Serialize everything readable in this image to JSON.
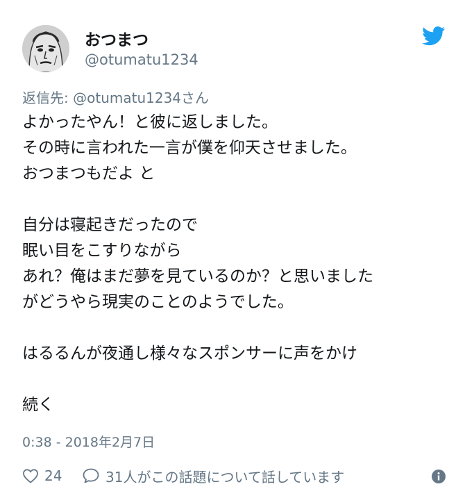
{
  "user": {
    "display_name": "おつまつ",
    "handle": "@otumatu1234"
  },
  "reply_to": {
    "prefix": "返信先: ",
    "mention": "@otumatu1234",
    "suffix": "さん"
  },
  "body_lines": [
    "よかったやん！と彼に返しました。",
    "その時に言われた一言が僕を仰天させました。",
    "おつまつもだよ と",
    "",
    "自分は寝起きだったので",
    "眠い目をこすりながら",
    "あれ？俺はまだ夢を見ているのか？と思いました",
    "がどうやら現実のことのようでした。",
    "",
    "はるるんが夜通し様々なスポンサーに声をかけ",
    "",
    "続く"
  ],
  "timestamp": "0:38 - 2018年2月7日",
  "actions": {
    "like_count": "24",
    "reply_text": "31人がこの話題について話しています"
  },
  "colors": {
    "brand": "#1da1f2",
    "secondary_text": "#657786",
    "primary_text": "#14171a"
  },
  "icons": {
    "brand": "twitter-bird-icon",
    "like": "heart-icon",
    "reply": "speech-bubble-icon",
    "info": "info-icon"
  }
}
